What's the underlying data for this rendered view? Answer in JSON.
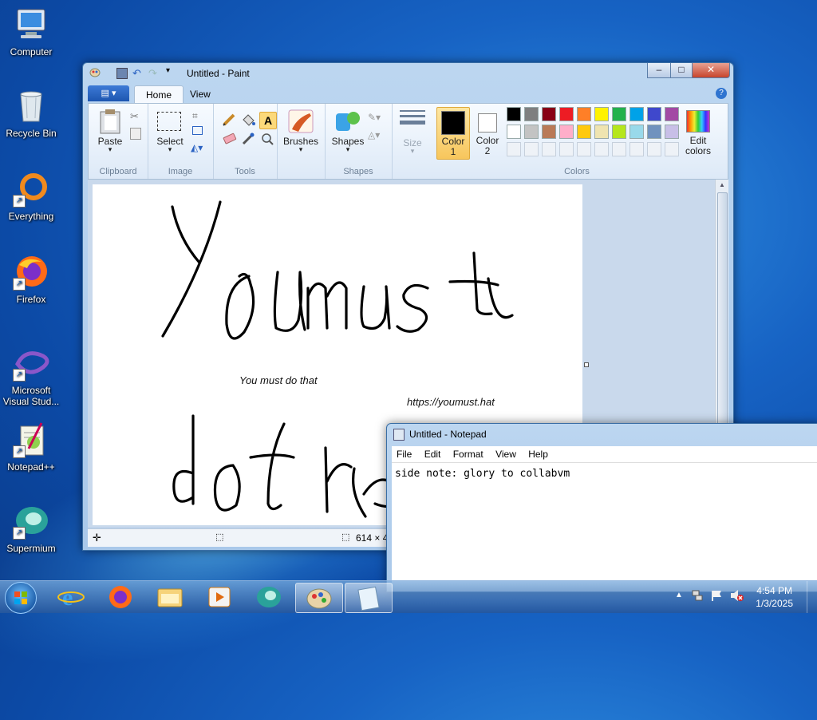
{
  "desktop": {
    "icons": [
      {
        "label": "Computer",
        "icon": "computer-icon"
      },
      {
        "label": "Recycle Bin",
        "icon": "recycle-bin-icon"
      },
      {
        "label": "Everything",
        "icon": "everything-search-icon"
      },
      {
        "label": "Firefox",
        "icon": "firefox-icon"
      },
      {
        "label": "Microsoft\nVisual Stud...",
        "icon": "visual-studio-icon"
      },
      {
        "label": "Notepad++",
        "icon": "notepad-plus-plus-icon"
      },
      {
        "label": "Supermium",
        "icon": "supermium-icon"
      }
    ]
  },
  "paint": {
    "title": "Untitled - Paint",
    "tabs": [
      "Home",
      "View"
    ],
    "groups": {
      "clipboard": {
        "label": "Clipboard",
        "paste": "Paste"
      },
      "image": {
        "label": "Image",
        "select": "Select"
      },
      "tools": {
        "label": "Tools"
      },
      "brushes": {
        "label": "Brushes"
      },
      "shapes": {
        "label": "Shapes",
        "shapes_btn": "Shapes"
      },
      "size": {
        "label": "Size"
      },
      "colors": {
        "label": "Colors",
        "color1": "Color\n1",
        "color2": "Color\n2",
        "edit": "Edit\ncolors"
      }
    },
    "palette_row1": [
      "#000000",
      "#7f7f7f",
      "#880015",
      "#ed1c24",
      "#ff7f27",
      "#fff200",
      "#22b14c",
      "#00a2e8",
      "#3f48cc",
      "#a349a4"
    ],
    "palette_row2": [
      "#ffffff",
      "#c3c3c3",
      "#b97a57",
      "#ffaec9",
      "#ffc90e",
      "#efe4b0",
      "#b5e61d",
      "#99d9ea",
      "#7092be",
      "#c8bfe7"
    ],
    "color1": "#000000",
    "color2": "#ffffff",
    "canvas": {
      "handwritten_line1": "Youmust",
      "handwritten_line2": "dothe",
      "text1": "You must do that",
      "text2": "https://youmust.hat"
    },
    "status_size": "614 × 4"
  },
  "notepad": {
    "title": "Untitled - Notepad",
    "menu": [
      "File",
      "Edit",
      "Format",
      "View",
      "Help"
    ],
    "content": "side note: glory to collabvm"
  },
  "taskbar": {
    "time": "4:54 PM",
    "date": "1/3/2025",
    "apps": [
      "start-orb-icon",
      "internet-explorer-icon",
      "firefox-icon",
      "file-explorer-icon",
      "media-player-icon",
      "supermium-icon",
      "paint-icon",
      "notepad-icon"
    ]
  }
}
